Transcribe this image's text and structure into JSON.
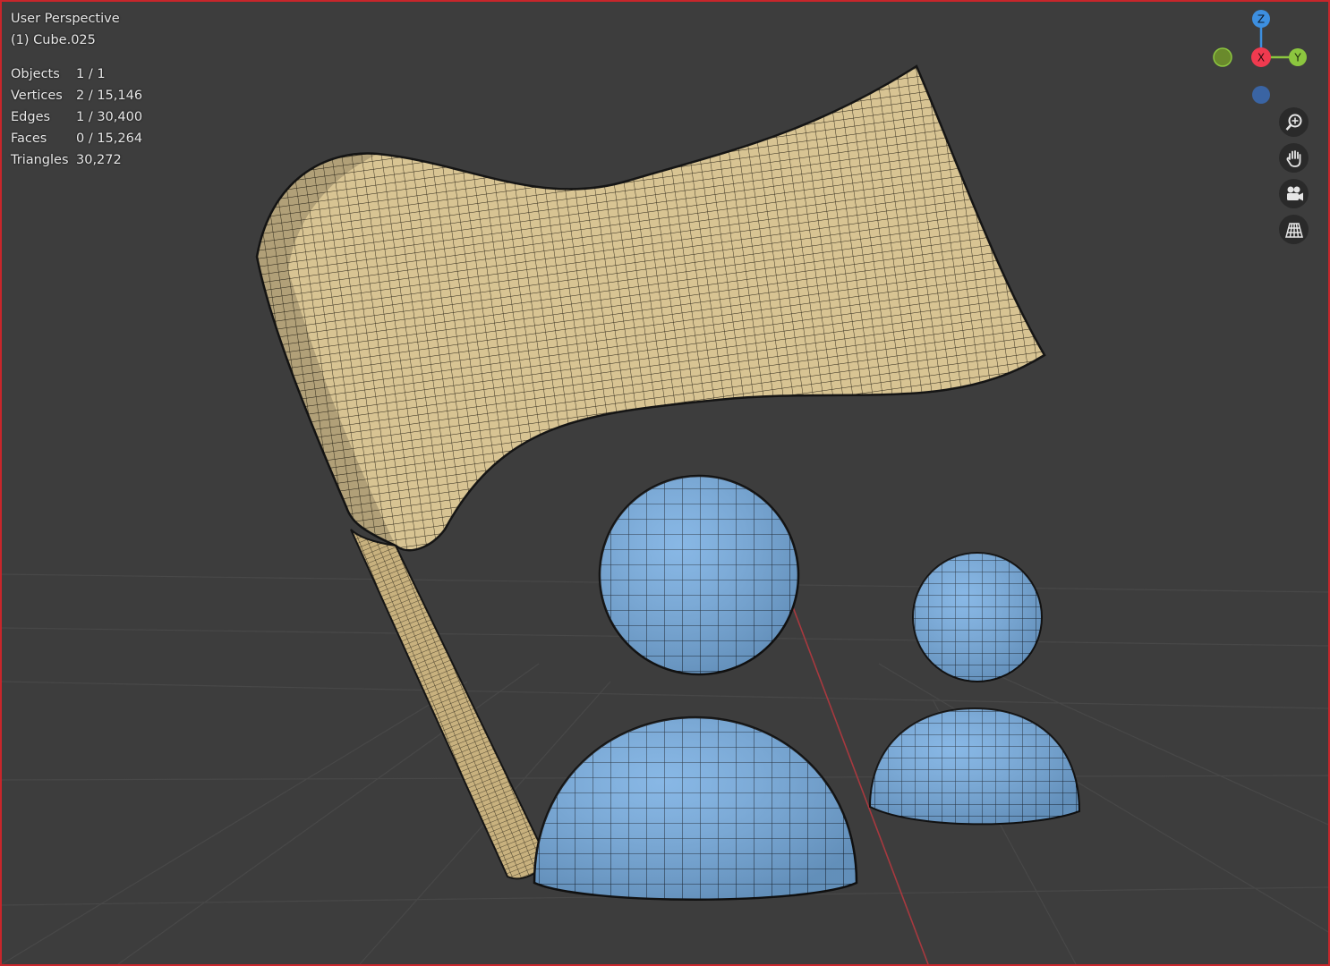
{
  "viewport": {
    "view_name": "User Perspective",
    "object_name": "(1) Cube.025"
  },
  "stats": [
    {
      "label": "Objects",
      "value": "1 / 1"
    },
    {
      "label": "Vertices",
      "value": "2 / 15,146"
    },
    {
      "label": "Edges",
      "value": "1 / 30,400"
    },
    {
      "label": "Faces",
      "value": "0 / 15,264"
    },
    {
      "label": "Triangles",
      "value": "30,272"
    }
  ],
  "gizmo": {
    "z_label": "Z",
    "x_label": "X",
    "y_label": "Y",
    "colors": {
      "z": "#3d8fe0",
      "x": "#f03a4f",
      "y": "#8cc63f",
      "neg_y": "#6a8a2c",
      "neg_z": "#3a64a3"
    }
  },
  "nav_icons": [
    "zoom-icon",
    "hand-pan-icon",
    "camera-icon",
    "grid-perspective-icon"
  ],
  "colors": {
    "background": "#3d3d3d",
    "flag": "#d8c493",
    "people": "#78aee2",
    "wire": "#1a1a1a",
    "frame": "#c8262b"
  }
}
